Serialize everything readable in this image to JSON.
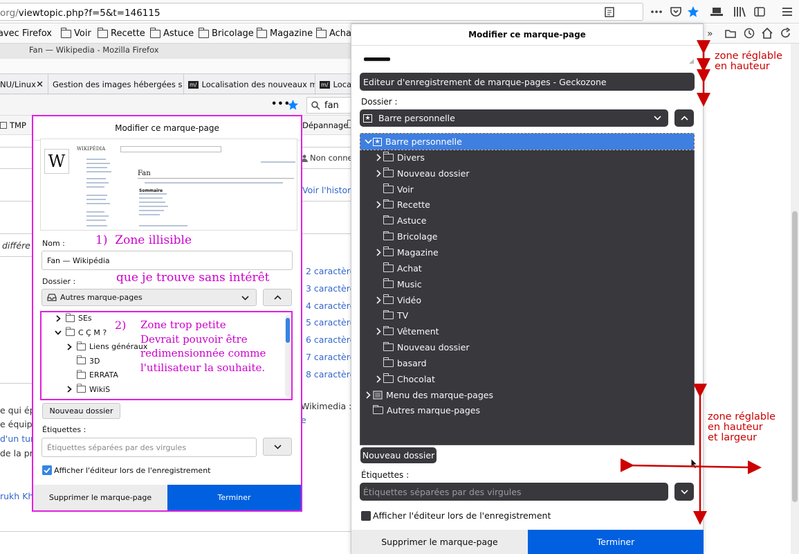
{
  "urlbar": {
    "url_prefix": "org/",
    "url_rest": "viewtopic.php?f=5&t=146115"
  },
  "bookmarks_toolbar": {
    "items": [
      "avec Firefox",
      "Voir",
      "Recette",
      "Astuce",
      "Bricolage",
      "Magazine",
      "Achat"
    ]
  },
  "inner_window": {
    "title": "Fan — Wikipedia - Mozilla Firefox",
    "tabs": [
      "NU/Linux",
      "Gestion des images hébergées s",
      "Localisation des nouveaux m",
      "Loca"
    ],
    "search_text": "fan",
    "bm_items": [
      "TMP",
      "Dépannage"
    ],
    "page_snippets": {
      "non_connecte": "Non connec",
      "voir_historique": "Voir l'historiq",
      "differe": "différe",
      "caracteres": [
        "2 caractère",
        "3 caractère",
        "4 caractère",
        "5 caractère",
        "6 caractère",
        "7 caractère",
        "8 caractère"
      ],
      "wikimedia": "Wikimedia :",
      "left_lines": [
        "e qui ép",
        "e équipe",
        "d'un tur",
        "de la pr"
      ],
      "rukh": "rukh Kh"
    }
  },
  "small_panel": {
    "title": "Modifier ce marque-page",
    "name_label": "Nom :",
    "name_value": "Fan — Wikipédia",
    "folder_label": "Dossier :",
    "folder_value": "Autres marque-pages",
    "tree": [
      {
        "label": "SEs",
        "level": 1,
        "chevron": "right"
      },
      {
        "label": "C Ç M ?",
        "level": 1,
        "chevron": "down"
      },
      {
        "label": "Liens généraux",
        "level": 2,
        "chevron": "right"
      },
      {
        "label": "3D",
        "level": 2,
        "chevron": ""
      },
      {
        "label": "ERRATA",
        "level": 2,
        "chevron": ""
      },
      {
        "label": "WikiS",
        "level": 2,
        "chevron": "right"
      }
    ],
    "new_folder": "Nouveau dossier",
    "tags_label": "Étiquettes :",
    "tags_placeholder": "Étiquettes séparées par des virgules",
    "show_editor": "Afficher l'éditeur lors de l'enregistrement",
    "remove": "Supprimer le marque-page",
    "done": "Terminer",
    "preview": {
      "heading": "Fan",
      "summary": "Sommaire"
    }
  },
  "notes": {
    "n1_num": "1)",
    "n1_a": "Zone illisible",
    "n1_b": "que je trouve sans intérêt",
    "n2_num": "2)",
    "n2_lines": [
      "Zone trop petite",
      "Devrait pouvoir être",
      "redimensionnée comme",
      "l'utilisateur la souhaite."
    ]
  },
  "large_panel": {
    "title": "Modifier ce marque-page",
    "name_value": "Editeur d'enregistrement de marque-pages - Geckozone",
    "folder_label": "Dossier :",
    "folder_value": "Barre personnelle",
    "tree": [
      {
        "label": "Barre personnelle",
        "level": 0,
        "chevron": "down",
        "icon": "star",
        "selected": true
      },
      {
        "label": "Divers",
        "level": 1,
        "chevron": "right",
        "icon": "folder"
      },
      {
        "label": "Nouveau dossier",
        "level": 1,
        "chevron": "right",
        "icon": "folder"
      },
      {
        "label": "Voir",
        "level": 1,
        "chevron": "",
        "icon": "folder"
      },
      {
        "label": "Recette",
        "level": 1,
        "chevron": "right",
        "icon": "folder"
      },
      {
        "label": "Astuce",
        "level": 1,
        "chevron": "",
        "icon": "folder"
      },
      {
        "label": "Bricolage",
        "level": 1,
        "chevron": "",
        "icon": "folder"
      },
      {
        "label": "Magazine",
        "level": 1,
        "chevron": "right",
        "icon": "folder"
      },
      {
        "label": "Achat",
        "level": 1,
        "chevron": "",
        "icon": "folder"
      },
      {
        "label": "Music",
        "level": 1,
        "chevron": "",
        "icon": "folder"
      },
      {
        "label": "Vidéo",
        "level": 1,
        "chevron": "right",
        "icon": "folder"
      },
      {
        "label": "TV",
        "level": 1,
        "chevron": "",
        "icon": "folder"
      },
      {
        "label": "Vêtement",
        "level": 1,
        "chevron": "right",
        "icon": "folder"
      },
      {
        "label": "Nouveau dossier",
        "level": 1,
        "chevron": "",
        "icon": "folder"
      },
      {
        "label": "basard",
        "level": 1,
        "chevron": "",
        "icon": "folder"
      },
      {
        "label": "Chocolat",
        "level": 1,
        "chevron": "right",
        "icon": "folder"
      },
      {
        "label": "Menu des marque-pages",
        "level": 0,
        "chevron": "right",
        "icon": "menu"
      },
      {
        "label": "Autres marque-pages",
        "level": 0,
        "chevron": "",
        "icon": "folder"
      }
    ],
    "new_folder": "Nouveau dossier",
    "tags_label": "Étiquettes :",
    "tags_placeholder": "Étiquettes séparées par des virgules",
    "show_editor": "Afficher l'éditeur lors de l'enregistrement",
    "remove": "Supprimer le marque-page",
    "done": "Terminer"
  },
  "annotations": {
    "top": [
      "zone réglable",
      "en hauteur"
    ],
    "bottom": [
      "zone réglable",
      "en hauteur",
      "et largeur"
    ]
  },
  "colors": {
    "accent": "#0a84ff",
    "done_button": "#0060df",
    "annot": "#cc0000",
    "magenta": "#e020e0",
    "dark_bg": "#38383d",
    "selected": "#3f7fe0"
  }
}
